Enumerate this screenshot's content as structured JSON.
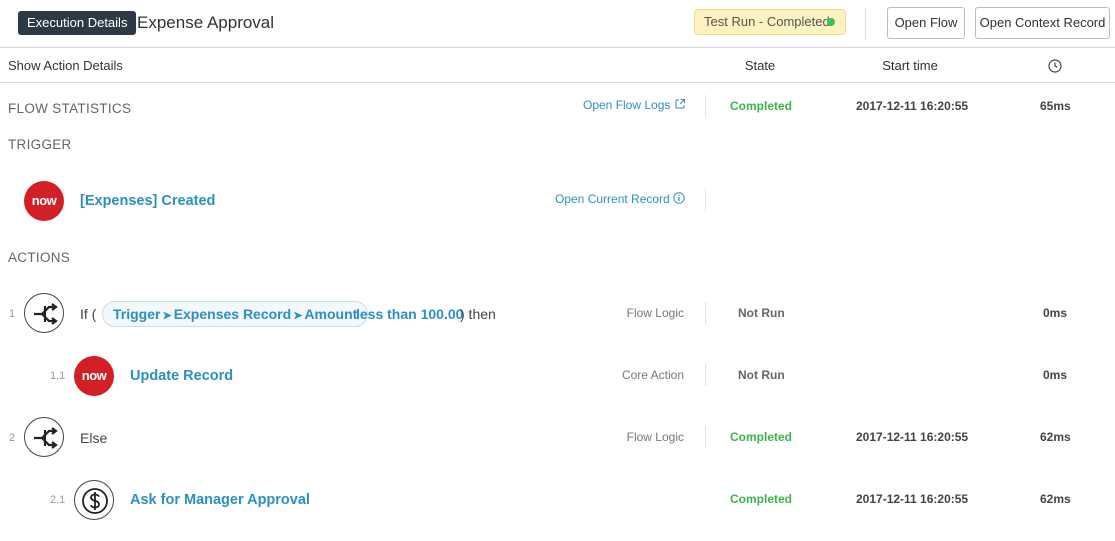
{
  "header": {
    "badge": "Execution Details",
    "title": "Expense Approval",
    "status": "Test Run - Completed",
    "open_flow": "Open Flow",
    "open_context_record": "Open Context Record"
  },
  "columns": {
    "show_details": "Show Action Details",
    "state": "State",
    "start_time": "Start time"
  },
  "flow_statistics": {
    "title": "FLOW STATISTICS",
    "logs_link": "Open Flow Logs",
    "state": "Completed",
    "start_time": "2017-12-11 16:20:55",
    "duration": "65ms"
  },
  "trigger": {
    "title": "TRIGGER",
    "icon_text": "now",
    "label": "[Expenses] Created",
    "record_link": "Open Current Record"
  },
  "actions": {
    "title": "ACTIONS",
    "rows": [
      {
        "num": "1",
        "prefix": "If (",
        "pill_parts": [
          "Trigger",
          "Expenses Record",
          "Amount"
        ],
        "condition": "less than 100.00",
        "suffix": ") then",
        "type": "Flow Logic",
        "state": "Not Run",
        "duration": "0ms"
      },
      {
        "num": "1.1",
        "icon_text": "now",
        "label": "Update Record",
        "type": "Core Action",
        "state": "Not Run",
        "duration": "0ms"
      },
      {
        "num": "2",
        "label": "Else",
        "type": "Flow Logic",
        "state": "Completed",
        "start_time": "2017-12-11 16:20:55",
        "duration": "62ms"
      },
      {
        "num": "2.1",
        "label": "Ask for Manager Approval",
        "state": "Completed",
        "start_time": "2017-12-11 16:20:55",
        "duration": "62ms"
      }
    ]
  },
  "colors": {
    "link": "#2c8fc6",
    "completed": "#3cb54a",
    "now_brand": "#d32027",
    "status_bg": "#fcf3c0"
  }
}
